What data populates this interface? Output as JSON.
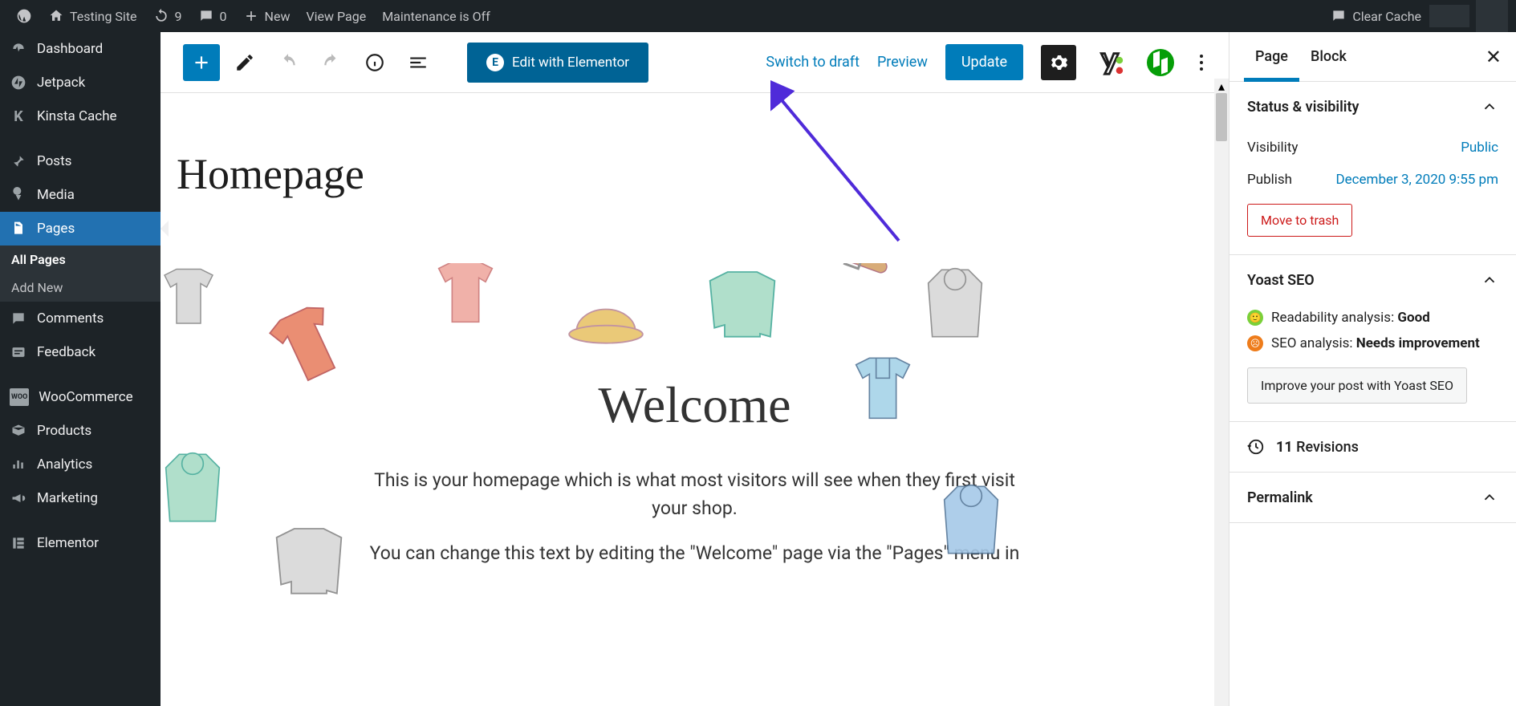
{
  "adminBar": {
    "siteName": "Testing Site",
    "updatesCount": "9",
    "commentsCount": "0",
    "newLabel": "New",
    "viewPage": "View Page",
    "maintenance": "Maintenance is Off",
    "clearCache": "Clear Cache"
  },
  "sidebar": {
    "items": [
      {
        "label": "Dashboard"
      },
      {
        "label": "Jetpack"
      },
      {
        "label": "Kinsta Cache"
      },
      {
        "label": "Posts"
      },
      {
        "label": "Media"
      },
      {
        "label": "Pages"
      },
      {
        "label": "Comments"
      },
      {
        "label": "Feedback"
      },
      {
        "label": "WooCommerce"
      },
      {
        "label": "Products"
      },
      {
        "label": "Analytics"
      },
      {
        "label": "Marketing"
      },
      {
        "label": "Elementor"
      }
    ],
    "pagesSubmenu": {
      "allPages": "All Pages",
      "addNew": "Add New"
    }
  },
  "toolbar": {
    "elementorLabel": "Edit with Elementor",
    "switchDraft": "Switch to draft",
    "preview": "Preview",
    "update": "Update"
  },
  "page": {
    "title": "Homepage",
    "hero": {
      "heading": "Welcome",
      "p1": "This is your homepage which is what most visitors will see when they first visit your shop.",
      "p2": "You can change this text by editing the \"Welcome\" page via the \"Pages\" menu in"
    }
  },
  "inspector": {
    "tabs": {
      "page": "Page",
      "block": "Block"
    },
    "status": {
      "heading": "Status & visibility",
      "visibilityLabel": "Visibility",
      "visibilityValue": "Public",
      "publishLabel": "Publish",
      "publishValue": "December 3, 2020 9:55 pm",
      "trash": "Move to trash"
    },
    "yoast": {
      "heading": "Yoast SEO",
      "readabilityLabel": "Readability analysis: ",
      "readabilityValue": "Good",
      "seoLabel": "SEO analysis: ",
      "seoValue": "Needs improvement",
      "improve": "Improve your post with Yoast SEO"
    },
    "revisions": {
      "count": "11",
      "label": " Revisions"
    },
    "permalink": "Permalink"
  }
}
